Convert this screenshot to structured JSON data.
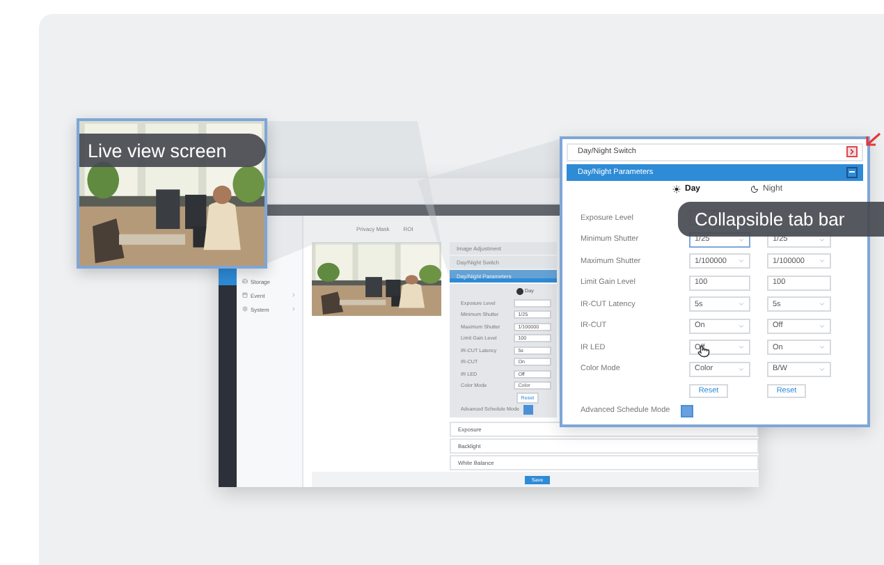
{
  "live_view": {
    "label": "Live view screen"
  },
  "zoom_callout": {
    "label": "Collapsible tab bar"
  },
  "app": {
    "tabs": [
      {
        "label": "Privacy Mask"
      },
      {
        "label": "ROI"
      }
    ],
    "nav": [
      {
        "label": "Storage",
        "expandable": false
      },
      {
        "label": "Event",
        "expandable": true
      },
      {
        "label": "System",
        "expandable": true
      }
    ],
    "sections_top": [
      "Image Adjustment",
      "Day/Night Switch"
    ],
    "active_section": "Day/Night Parameters",
    "mode": {
      "label": "Day",
      "selected": true
    },
    "rows": [
      {
        "label": "Exposure Level"
      },
      {
        "label": "Minimum Shutter",
        "value": "1/25"
      },
      {
        "label": "Maximum Shutter",
        "value": "1/100000"
      },
      {
        "label": "Limit Gain Level",
        "value": "100"
      },
      {
        "label": "IR-CUT Latency",
        "value": "5s"
      },
      {
        "label": "IR-CUT",
        "value": "On"
      },
      {
        "label": "IR LED",
        "value": "Off"
      },
      {
        "label": "Color Mode",
        "value": "Color"
      }
    ],
    "reset": "Reset",
    "advanced": {
      "label": "Advanced Schedule Mode",
      "checked": true
    },
    "sections_bottom": [
      "Exposure",
      "Backlight",
      "White Balance"
    ],
    "save": "Save"
  },
  "panel": {
    "switch_bar": {
      "label": "Day/Night Switch",
      "expanded": false
    },
    "params_bar": {
      "label": "Day/Night Parameters",
      "expanded": true
    },
    "modes": [
      {
        "label": "Day",
        "selected": true
      },
      {
        "label": "Night",
        "selected": false
      }
    ],
    "rows": [
      {
        "label": "Exposure Level",
        "kind": "covered"
      },
      {
        "label": "Minimum Shutter",
        "kind": "select",
        "values": [
          "1/25",
          "1/25"
        ]
      },
      {
        "label": "Maximum Shutter",
        "kind": "select",
        "values": [
          "1/100000",
          "1/100000"
        ]
      },
      {
        "label": "Limit Gain Level",
        "kind": "input",
        "values": [
          "100",
          "100"
        ]
      },
      {
        "label": "IR-CUT Latency",
        "kind": "select",
        "values": [
          "5s",
          "5s"
        ]
      },
      {
        "label": "IR-CUT",
        "kind": "select",
        "values": [
          "On",
          "Off"
        ]
      },
      {
        "label": "IR LED",
        "kind": "select",
        "values": [
          "Off",
          "On"
        ]
      },
      {
        "label": "Color Mode",
        "kind": "select",
        "values": [
          "Color",
          "B/W"
        ]
      }
    ],
    "reset_buttons": [
      "Reset",
      "Reset"
    ],
    "advanced": {
      "label": "Advanced Schedule Mode",
      "checked": true
    }
  }
}
